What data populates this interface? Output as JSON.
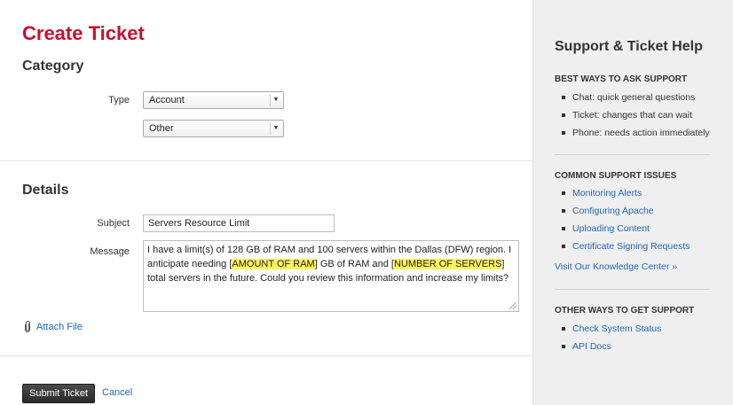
{
  "page_title": "Create Ticket",
  "category": {
    "heading": "Category",
    "type_label": "Type",
    "type_value": "Account",
    "subtype_value": "Other"
  },
  "details": {
    "heading": "Details",
    "subject_label": "Subject",
    "subject_value": "Servers Resource Limit",
    "message_label": "Message",
    "message_part1": "I have a limit(s) of 128 GB of RAM and 100 servers within the Dallas (DFW) region. I anticipate needing [",
    "message_hl1": "AMOUNT OF RAM",
    "message_part2": "] GB of RAM and [",
    "message_hl2": "NUMBER OF SERVERS",
    "message_part3": "] total servers in the future. Could you review this information and increase my limits?",
    "attach_label": "Attach File"
  },
  "actions": {
    "submit_label": "Submit Ticket",
    "cancel_label": "Cancel"
  },
  "sidebar": {
    "title": "Support & Ticket Help",
    "ways": {
      "heading": "BEST WAYS TO ASK SUPPORT",
      "items": [
        "Chat: quick general questions",
        "Ticket: changes that can wait",
        "Phone: needs action immediately"
      ]
    },
    "issues": {
      "heading": "COMMON SUPPORT ISSUES",
      "items": [
        "Monitoring Alerts",
        "Configuring Apache",
        "Uploading Content",
        "Certificate Signing Requests"
      ],
      "knowledge_link": "Visit Our Knowledge Center »"
    },
    "other": {
      "heading": "OTHER WAYS TO GET SUPPORT",
      "items": [
        "Check System Status",
        "API Docs"
      ]
    }
  },
  "colors": {
    "title_red": "#c8102e",
    "link_blue": "#1f66b3",
    "highlight_yellow": "#fff35c"
  }
}
